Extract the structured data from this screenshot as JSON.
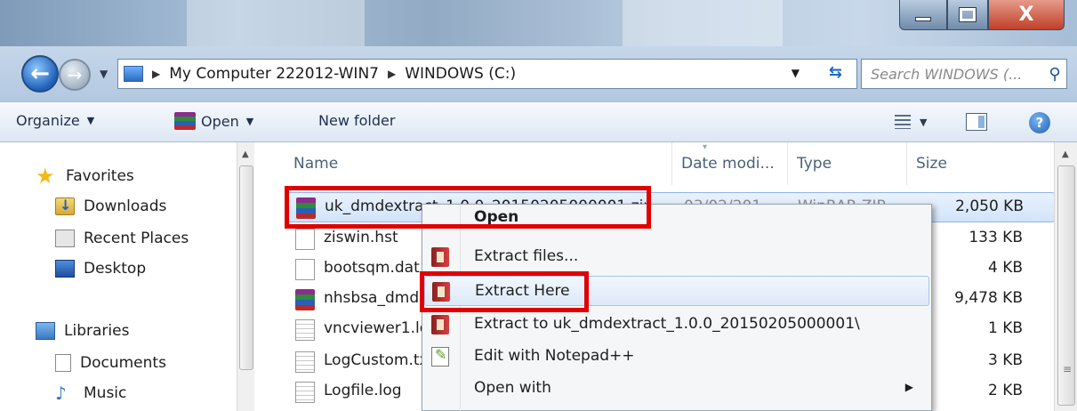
{
  "window": {
    "controls": {
      "minimize": "",
      "maximize": "",
      "close": "X"
    }
  },
  "addressbar": {
    "crumbs": [
      "My Computer 222012-WIN7",
      "WINDOWS (C:)"
    ],
    "search_placeholder": "Search WINDOWS (..."
  },
  "toolbar": {
    "organize": "Organize",
    "open": "Open",
    "new_folder": "New folder"
  },
  "navpane": {
    "favorites": "Favorites",
    "downloads": "Downloads",
    "recent_places": "Recent Places",
    "desktop": "Desktop",
    "libraries": "Libraries",
    "documents": "Documents",
    "music": "Music"
  },
  "filelist": {
    "columns": {
      "name": "Name",
      "date": "Date modi...",
      "type": "Type",
      "size": "Size"
    },
    "files": [
      {
        "name": "uk_dmdextract_1.0.0_20150205000001.zip",
        "date": "03/02/201",
        "type": "WinRAR ZIP",
        "size": "2,050 KB",
        "icon": "winrar-archive-icon"
      },
      {
        "name": "ziswin.hst",
        "size": "133 KB",
        "icon": "file-icon"
      },
      {
        "name": "bootsqm.dat",
        "size": "4 KB",
        "icon": "file-icon"
      },
      {
        "name": "nhsbsa_dmd",
        "size": "9,478 KB",
        "icon": "winrar-archive-icon"
      },
      {
        "name": "vncviewer1.log",
        "size": "1 KB",
        "icon": "log-file-icon"
      },
      {
        "name": "LogCustom.txt",
        "size": "3 KB",
        "icon": "log-file-icon"
      },
      {
        "name": "Logfile.log",
        "size": "2 KB",
        "icon": "log-file-icon"
      }
    ]
  },
  "context_menu": {
    "items": [
      {
        "label": "Open",
        "icon": ""
      },
      {
        "label": "Extract files...",
        "icon": "winrar-icon"
      },
      {
        "label": "Extract Here",
        "icon": "winrar-icon"
      },
      {
        "label": "Extract to uk_dmdextract_1.0.0_20150205000001\\",
        "icon": "winrar-icon"
      },
      {
        "label": "Edit with Notepad++",
        "icon": "notepad-plus-plus-icon"
      },
      {
        "label": "Open with",
        "icon": ""
      }
    ]
  },
  "colors": {
    "callout": "#e00000",
    "selection": "#d2e4fa"
  }
}
